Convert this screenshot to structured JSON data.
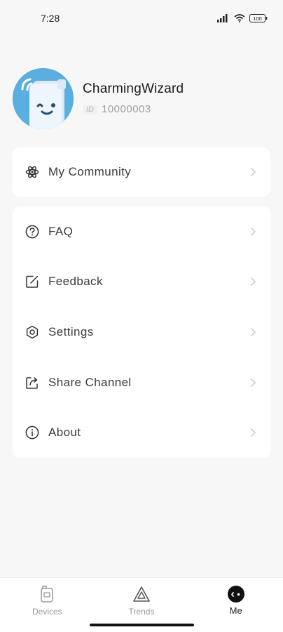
{
  "status_bar": {
    "time": "7:28",
    "icons": [
      "signal-icon",
      "wifi-icon",
      "battery-icon"
    ],
    "battery_level": "100"
  },
  "profile": {
    "username": "CharmingWizard",
    "id_label": "ID",
    "id_value": "10000003",
    "avatar_color": "#5aaee0"
  },
  "community_card": {
    "items": [
      {
        "label": "My Community",
        "icon": "community-icon"
      }
    ]
  },
  "menu": {
    "items": [
      {
        "label": "FAQ",
        "icon": "question-icon"
      },
      {
        "label": "Feedback",
        "icon": "feedback-icon"
      },
      {
        "label": "Settings",
        "icon": "settings-icon"
      },
      {
        "label": "Share Channel",
        "icon": "share-icon"
      },
      {
        "label": "About",
        "icon": "info-icon"
      }
    ]
  },
  "tabbar": {
    "tabs": [
      {
        "label": "Devices",
        "icon": "devices-icon",
        "active": false
      },
      {
        "label": "Trends",
        "icon": "trends-icon",
        "active": false
      },
      {
        "label": "Me",
        "icon": "me-icon",
        "active": true
      }
    ]
  }
}
